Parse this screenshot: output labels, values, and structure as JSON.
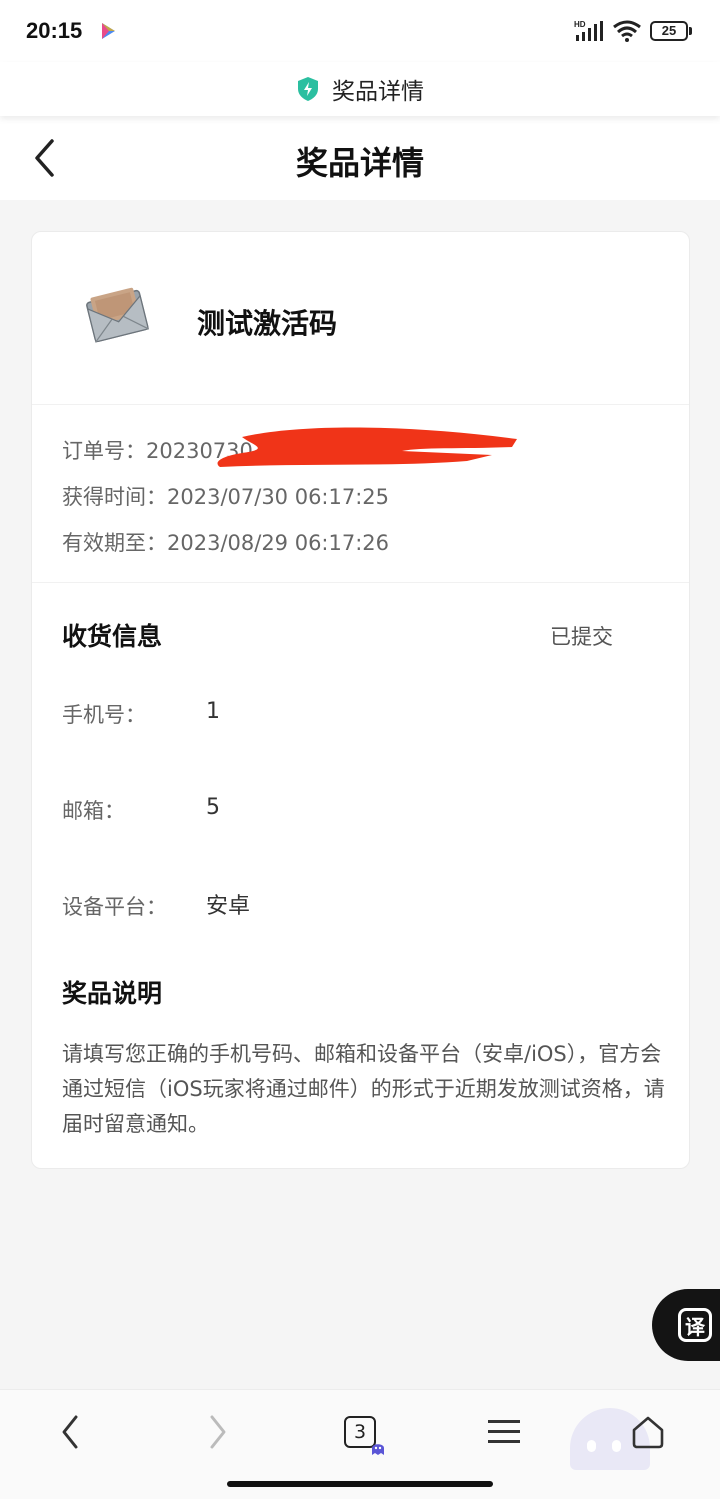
{
  "status_bar": {
    "time": "20:15",
    "network": "HD",
    "battery": "25"
  },
  "url_bar": {
    "title": "奖品详情"
  },
  "header": {
    "title": "奖品详情"
  },
  "prize": {
    "name": "测试激活码"
  },
  "order": {
    "order_no": "订单号：20230730",
    "obtained": "获得时间：2023/07/30 06:17:25",
    "expires": "有效期至：2023/08/29 06:17:26"
  },
  "shipping": {
    "title": "收货信息",
    "status": "已提交",
    "phone_label": "手机号：",
    "phone_value": "1",
    "email_label": "邮箱：",
    "email_value": "5",
    "platform_label": "设备平台：",
    "platform_value": "安卓"
  },
  "description": {
    "title": "奖品说明",
    "text": "请填写您正确的手机号码、邮箱和设备平台（安卓/iOS），官方会通过短信（iOS玩家将通过邮件）的形式于近期发放测试资格，请届时留意通知。"
  },
  "translate": {
    "label": "译"
  },
  "bottom_nav": {
    "tab_count": "3"
  },
  "colors": {
    "accent": "#2bbfa0",
    "redaction": "#f03418",
    "card_bg": "#ffffff",
    "page_bg": "#f5f5f5"
  }
}
